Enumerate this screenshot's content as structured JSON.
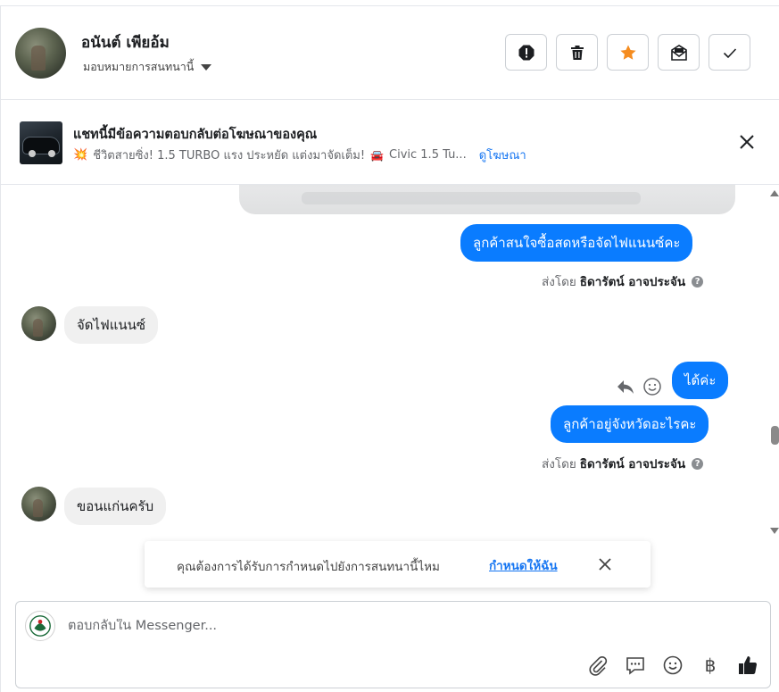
{
  "header": {
    "contact_name": "อนันต์ เพียอ้ม",
    "assign_label": "มอบหมายการสนทนานี้",
    "actions": [
      "spam-icon",
      "trash-icon",
      "star-icon",
      "mark-unread-icon",
      "done-check-icon"
    ],
    "star_color": "#f58c1f"
  },
  "ad_banner": {
    "title": "แชทนี้มีข้อความตอบกลับต่อโฆษณาของคุณ",
    "text_a": "ชีวิตสายซิ่ง! 1.5 TURBO แรง ประหยัด แต่งมาจัดเต็ม!",
    "text_b": "Civic 1.5 Tu...",
    "link": "ดูโฆษณา"
  },
  "messages": {
    "out_1": "ลูกค้าสนใจซื้อสดหรือจัดไฟแนนซ์คะ",
    "sent_by_prefix": "ส่งโดย",
    "sender": "ธิดารัตน์ อาจประจัน",
    "in_1": "จัดไฟแนนซ์",
    "out_2": "ได้ค่ะ",
    "out_3": "ลูกค้าอยู่จังหวัดอะไรคะ",
    "in_2": "ขอนแก่นครับ"
  },
  "toast": {
    "text": "คุณต้องการได้รับการกำหนดไปยังการสนทนานี้ไหม",
    "link": "กำหนดให้ฉัน"
  },
  "composer": {
    "placeholder": "ตอบกลับใน Messenger...",
    "baht_symbol": "฿",
    "tools": [
      "attach-icon",
      "saved-reply-icon",
      "emoji-icon",
      "baht-icon",
      "thumbs-up-icon"
    ]
  },
  "colors": {
    "accent": "#0a7cff",
    "link": "#1877f2"
  }
}
